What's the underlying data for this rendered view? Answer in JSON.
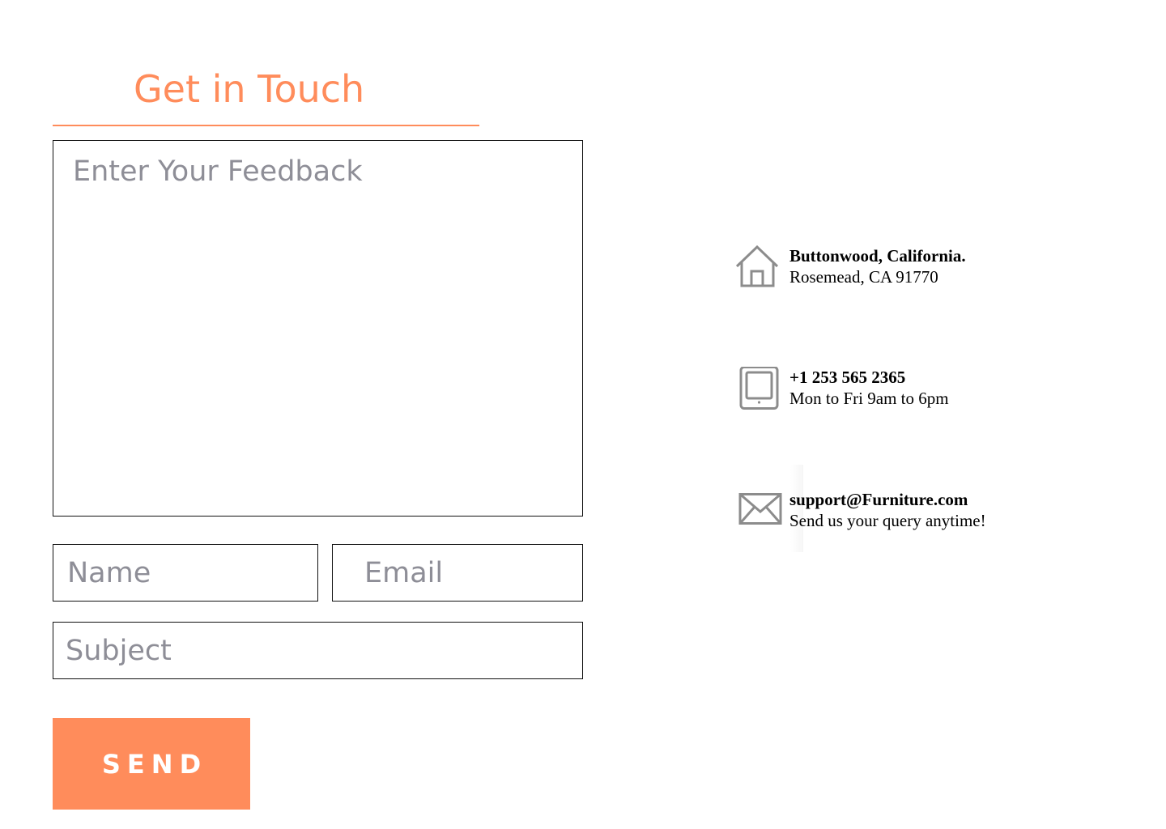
{
  "form": {
    "title": "Get in Touch",
    "feedback_placeholder": "Enter Your Feedback",
    "name_placeholder": "Name",
    "email_placeholder": "Email",
    "subject_placeholder": "Subject",
    "send_label": "SEND"
  },
  "contact": {
    "address": {
      "icon": "home-icon",
      "line1": "Buttonwood, California.",
      "line2": "Rosemead, CA 91770"
    },
    "phone": {
      "icon": "tablet-icon",
      "line1": "+1 253 565 2365",
      "line2": "Mon to Fri 9am to 6pm"
    },
    "email": {
      "icon": "envelope-icon",
      "line1": "support@Furniture.com",
      "line2": "Send us your query anytime!"
    }
  },
  "colors": {
    "accent": "#FF8C5B",
    "placeholder": "#8E8E97",
    "border": "#111111",
    "icon": "#8C8C8C"
  }
}
